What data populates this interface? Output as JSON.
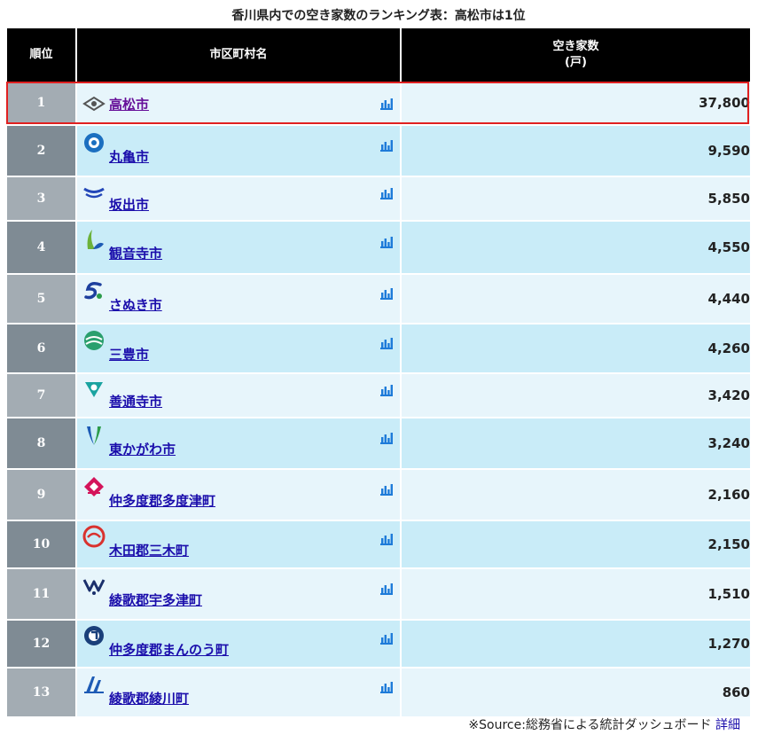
{
  "caption": "香川県内での空き家数のランキング表：高松市は1位",
  "headers": {
    "rank": "順位",
    "name": "市区町村名",
    "value_line1": "空き家数",
    "value_line2": "(戸)"
  },
  "rows": [
    {
      "rank": "1",
      "name": "高松市",
      "value": "37,800",
      "icon": "takamatsu-emblem-icon"
    },
    {
      "rank": "2",
      "name": "丸亀市",
      "value": "9,590",
      "icon": "marugame-emblem-icon"
    },
    {
      "rank": "3",
      "name": "坂出市",
      "value": "5,850",
      "icon": "sakaide-emblem-icon"
    },
    {
      "rank": "4",
      "name": "観音寺市",
      "value": "4,550",
      "icon": "kanonji-emblem-icon"
    },
    {
      "rank": "5",
      "name": "さぬき市",
      "value": "4,440",
      "icon": "sanuki-emblem-icon"
    },
    {
      "rank": "6",
      "name": "三豊市",
      "value": "4,260",
      "icon": "mitoyo-emblem-icon"
    },
    {
      "rank": "7",
      "name": "善通寺市",
      "value": "3,420",
      "icon": "zentsuji-emblem-icon"
    },
    {
      "rank": "8",
      "name": "東かがわ市",
      "value": "3,240",
      "icon": "higashikagawa-emblem-icon"
    },
    {
      "rank": "9",
      "name": "仲多度郡多度津町",
      "value": "2,160",
      "icon": "tadotsu-emblem-icon"
    },
    {
      "rank": "10",
      "name": "木田郡三木町",
      "value": "2,150",
      "icon": "miki-emblem-icon"
    },
    {
      "rank": "11",
      "name": "綾歌郡宇多津町",
      "value": "1,510",
      "icon": "utazu-emblem-icon"
    },
    {
      "rank": "12",
      "name": "仲多度郡まんのう町",
      "value": "1,270",
      "icon": "manno-emblem-icon"
    },
    {
      "rank": "13",
      "name": "綾歌郡綾川町",
      "value": "860",
      "icon": "ayagawa-emblem-icon"
    }
  ],
  "source": {
    "text": "※Source:総務省による統計ダッシュボード",
    "link": "詳細"
  },
  "colors": {
    "header_bg": "#000000",
    "rank_odd": "#a3acb3",
    "rank_even": "#7f8b94",
    "row_odd": "#e7f5fb",
    "row_even": "#c9ecf8",
    "link": "#1a0dab",
    "visited_link": "#660f99",
    "highlight": "#e02020",
    "bar_icon": "#1e7bd9"
  }
}
